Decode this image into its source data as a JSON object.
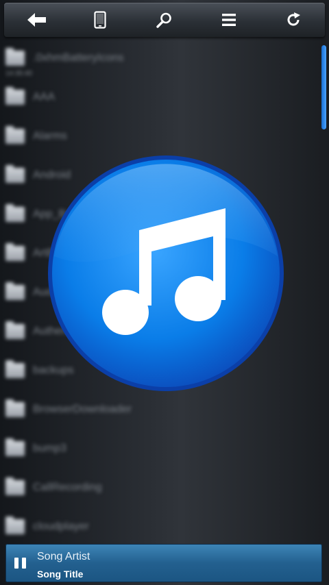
{
  "toolbar": {
    "buttons": [
      {
        "icon": "back-arrow-icon"
      },
      {
        "icon": "phone-icon"
      },
      {
        "icon": "search-icon"
      },
      {
        "icon": "menu-icon"
      },
      {
        "icon": "refresh-icon"
      }
    ]
  },
  "files": [
    {
      "name": ".0xhmBatteryIcons",
      "sub": "14:35:40"
    },
    {
      "name": "AAA"
    },
    {
      "name": "Alarms"
    },
    {
      "name": "Android"
    },
    {
      "name": "App_Backup"
    },
    {
      "name": "ArtBook"
    },
    {
      "name": "AudioBooks"
    },
    {
      "name": "Authenticator"
    },
    {
      "name": "backups"
    },
    {
      "name": "BrowserDownloader"
    },
    {
      "name": "bump3"
    },
    {
      "name": "CallRecording"
    },
    {
      "name": "cloudplayer"
    }
  ],
  "logo": {
    "icon": "music-note-icon",
    "color": "#0a7de8"
  },
  "player": {
    "artist": "Song Artist",
    "title": "Song Title",
    "accent": "#2a6ea0"
  }
}
